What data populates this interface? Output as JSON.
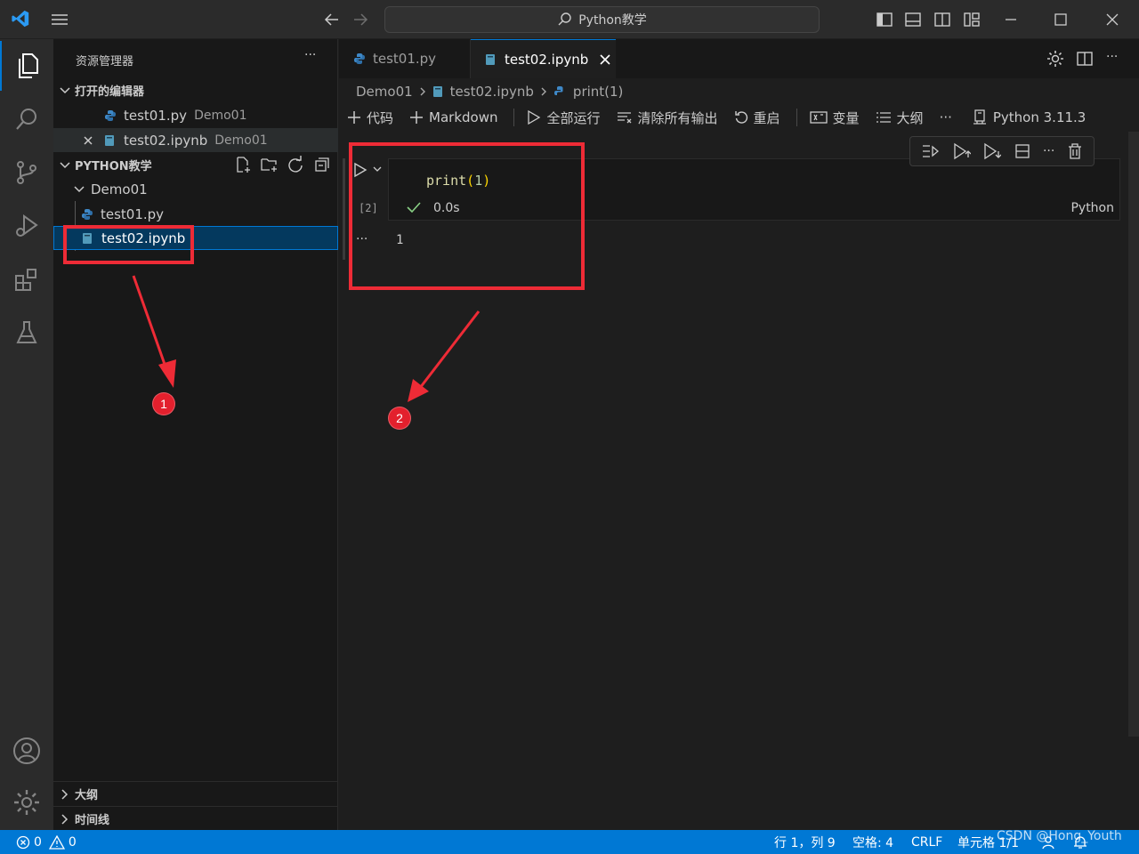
{
  "titlebar": {
    "search_text": "Python教学"
  },
  "sidebar": {
    "title": "资源管理器",
    "more": "···",
    "open_editors_label": "打开的编辑器",
    "open_editors": [
      {
        "name": "test01.py",
        "folder": "Demo01"
      },
      {
        "name": "test02.ipynb",
        "folder": "Demo01"
      }
    ],
    "workspace_label": "PYTHON教学",
    "folder": "Demo01",
    "files": [
      "test01.py",
      "test02.ipynb"
    ],
    "outline_label": "大纲",
    "timeline_label": "时间线"
  },
  "tabs": [
    {
      "label": "test01.py"
    },
    {
      "label": "test02.ipynb"
    }
  ],
  "breadcrumb": {
    "folder": "Demo01",
    "file": "test02.ipynb",
    "symbol": "print(1)"
  },
  "notebook_toolbar": {
    "code": "代码",
    "markdown": "Markdown",
    "run_all": "全部运行",
    "clear_outputs": "清除所有输出",
    "restart": "重启",
    "variables": "变量",
    "outline": "大纲",
    "more": "···",
    "kernel": "Python 3.11.3"
  },
  "cell": {
    "code_fn": "print",
    "code_open": "(",
    "code_arg": "1",
    "code_close": ")",
    "exec_count": "[2]",
    "duration": "0.0s",
    "language": "Python",
    "output_marker": "···",
    "output": "1"
  },
  "statusbar": {
    "errors": "0",
    "warnings": "0",
    "position": "行 1，列 9",
    "spaces": "空格: 4",
    "eol": "CRLF",
    "cell": "单元格 1/1",
    "watermark": "CSDN @Hong_Youth"
  },
  "annotations": {
    "badge1": "1",
    "badge2": "2"
  },
  "colors": {
    "accent": "#0078d4",
    "annotation": "#ee2b36",
    "statusbar": "#0078d4"
  }
}
